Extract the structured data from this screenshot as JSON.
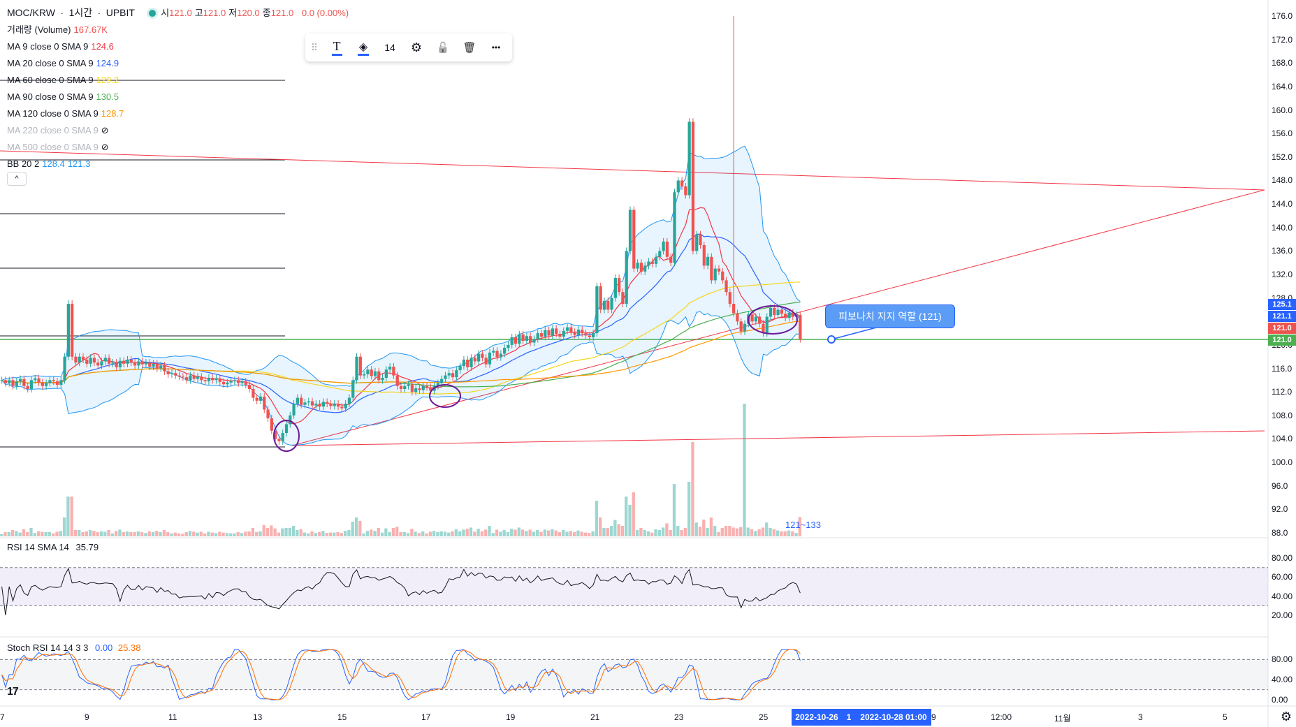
{
  "header": {
    "symbol": "MOC/KRW",
    "sep1": "·",
    "interval": "1시간",
    "sep2": "·",
    "exchange": "UPBIT",
    "ohlc": [
      {
        "label": "시",
        "value": "121.0"
      },
      {
        "label": "고",
        "value": "121.0"
      },
      {
        "label": "저",
        "value": "120.0"
      },
      {
        "label": "종",
        "value": "121.0"
      }
    ],
    "change": "0.0 (0.00%)"
  },
  "indicators": [
    {
      "label": "거래량 (Volume)",
      "value": "167.67K",
      "color": "#ef5350",
      "hidden": false
    },
    {
      "label": "MA 9 close 0 SMA 9",
      "value": "124.6",
      "color": "#f23645",
      "hidden": false
    },
    {
      "label": "MA 20 close 0 SMA 9",
      "value": "124.9",
      "color": "#2962ff",
      "hidden": false
    },
    {
      "label": "MA 60 close 0 SMA 9",
      "value": "129.2",
      "color": "#f5d61b",
      "hidden": false
    },
    {
      "label": "MA 90 close 0 SMA 9",
      "value": "130.5",
      "color": "#4caf50",
      "hidden": false
    },
    {
      "label": "MA 120 close 0 SMA 9",
      "value": "128.7",
      "color": "#ff9800",
      "hidden": false
    },
    {
      "label": "MA 220 close 0 SMA 9",
      "value": "",
      "color": "#b2b5be",
      "hidden": true
    },
    {
      "label": "MA 500 close 0 SMA 9",
      "value": "",
      "color": "#b2b5be",
      "hidden": true
    },
    {
      "label": "BB 20 2",
      "value": "128.4",
      "value2": "121.3",
      "color": "#2196f3",
      "hidden": false
    }
  ],
  "toolbar": {
    "grip_icon": "⠿",
    "text_icon": "T",
    "fill_icon": "◈",
    "font_size": "14",
    "settings_icon": "⚙",
    "lock_icon": "🔓",
    "delete_icon": "🗑",
    "more_icon": "•••"
  },
  "annotations": {
    "callout": "피보나치 지지 역할 (121)",
    "range_note": "121~133"
  },
  "price_axis": {
    "ticks": [
      "176.0",
      "172.0",
      "168.0",
      "164.0",
      "160.0",
      "156.0",
      "152.0",
      "148.0",
      "144.0",
      "140.0",
      "136.0",
      "132.0",
      "128.0",
      "120.0",
      "116.0",
      "112.0",
      "108.0",
      "104.0",
      "100.0",
      "96.0",
      "92.0",
      "88.0"
    ],
    "badges": [
      {
        "value": "125.1",
        "color": "#2962ff"
      },
      {
        "value": "121.1",
        "color": "#2962ff"
      },
      {
        "value": "121.0",
        "color": "#ef5350"
      },
      {
        "value": "121.0",
        "color": "#4caf50"
      }
    ]
  },
  "rsi": {
    "label": "RSI 14 SMA 14",
    "value": "35.79",
    "ticks": [
      "80.00",
      "60.00",
      "40.00",
      "20.00"
    ]
  },
  "stoch": {
    "label": "Stoch RSI 14 14 3 3",
    "k": "0.00",
    "d": "25.38",
    "ticks": [
      "80.00",
      "40.00",
      "0.00"
    ]
  },
  "time_axis": {
    "ticks": [
      "7",
      "9",
      "11",
      "13",
      "15",
      "17",
      "19",
      "21",
      "23",
      "25",
      "12:00",
      "11월",
      "3",
      "5"
    ],
    "range_start": "2022-10-26",
    "range_mid": "1",
    "range_end": "2022-10-28  01:00",
    "range_tail": "9"
  },
  "brand": {
    "logo": "17"
  },
  "settings_icon": "⚙",
  "chart_data": {
    "type": "candlestick",
    "ylim": [
      88,
      176
    ],
    "key_levels": [
      121.0
    ],
    "close": [
      114,
      113.5,
      114,
      113,
      113.8,
      114.2,
      113,
      112.5,
      114,
      114.3,
      113.6,
      113,
      113.5,
      114,
      113.8,
      113.2,
      114,
      118,
      127,
      118,
      117,
      118,
      117.5,
      116.8,
      117.8,
      117,
      116.5,
      117.2,
      117.8,
      116.8,
      117,
      116.2,
      117.3,
      116.8,
      117.5,
      117,
      116.5,
      117.2,
      116.7,
      117,
      116.3,
      116.8,
      116,
      116.5,
      115.5,
      115,
      115.2,
      114.8,
      114.6,
      114.5,
      114,
      114.8,
      114.2,
      114.6,
      114,
      113.8,
      114.4,
      114,
      114.3,
      113.7,
      113.3,
      113.6,
      113.8,
      114,
      113.5,
      113.8,
      113.2,
      112.5,
      111,
      110.5,
      111.2,
      109,
      107.5,
      105.4,
      104,
      103.6,
      105,
      106.5,
      108,
      110,
      111,
      109.8,
      110.2,
      110.4,
      109.7,
      110,
      109.5,
      110.3,
      110,
      109.6,
      110,
      109.5,
      109.2,
      110,
      111,
      114,
      118,
      114.8,
      115,
      115.8,
      114.7,
      115.5,
      114,
      114.4,
      115.8,
      116.3,
      114.8,
      113,
      112.5,
      113,
      113.3,
      112,
      112.6,
      112.3,
      113,
      112.8,
      112.2,
      113,
      113.5,
      114.2,
      114.8,
      115.2,
      114.5,
      115.7,
      116.4,
      117.5,
      116.2,
      117.8,
      117.2,
      118.5,
      117.8,
      116.7,
      118.7,
      119,
      117.9,
      118.5,
      119.5,
      120,
      121.3,
      120.2,
      121.8,
      120.7,
      121.5,
      120.4,
      121,
      122,
      121.4,
      122.5,
      121.6,
      122.8,
      121.9,
      121.4,
      122.4,
      123,
      122.2,
      121.7,
      122.6,
      122,
      121.6,
      121.3,
      122,
      130,
      126,
      127.5,
      126,
      128,
      131.4,
      129,
      127,
      136,
      143,
      133,
      134,
      132.5,
      133.5,
      134.2,
      133.8,
      135,
      136,
      137.6,
      135,
      134,
      146,
      148,
      147,
      145.5,
      158,
      136,
      138.8,
      137,
      133.5,
      135,
      131,
      133,
      132.5,
      131,
      129,
      127,
      125.4,
      124,
      122.3,
      123.6,
      125.2,
      124,
      124.8,
      123.6,
      122,
      124.8,
      126.3,
      125.1,
      126,
      125.3,
      124.6,
      125.5,
      124.8,
      125.1,
      121
    ]
  }
}
